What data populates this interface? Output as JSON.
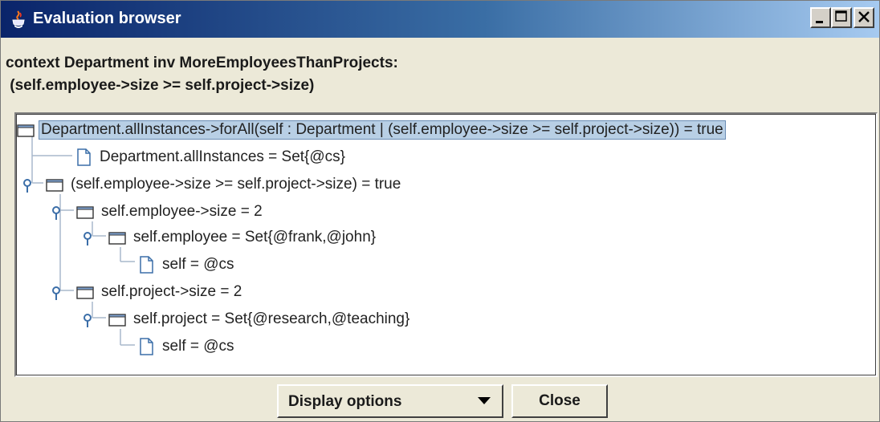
{
  "window": {
    "title": "Evaluation browser",
    "title_icon": "java-cup-icon",
    "controls": [
      "minimize-icon",
      "maximize-icon",
      "close-icon"
    ]
  },
  "context": {
    "line1": "context Department inv MoreEmployeesThanProjects:",
    "line2": " (self.employee->size >= self.project->size)"
  },
  "tree": {
    "nodes": [
      {
        "label": "Department.allInstances->forAll(self : Department | (self.employee->size >= self.project->size)) = true",
        "icon": "folder-icon",
        "selected": true
      },
      {
        "label": "Department.allInstances = Set{@cs}",
        "icon": "leaf-document-icon"
      },
      {
        "label": "(self.employee->size >= self.project->size) = true",
        "icon": "folder-icon"
      },
      {
        "label": "self.employee->size = 2",
        "icon": "folder-icon"
      },
      {
        "label": "self.employee = Set{@frank,@john}",
        "icon": "folder-icon"
      },
      {
        "label": "self = @cs",
        "icon": "leaf-document-icon"
      },
      {
        "label": "self.project->size = 2",
        "icon": "folder-icon"
      },
      {
        "label": "self.project = Set{@research,@teaching}",
        "icon": "folder-icon"
      },
      {
        "label": "self = @cs",
        "icon": "leaf-document-icon"
      }
    ]
  },
  "footer": {
    "display_options_label": "Display options",
    "close_label": "Close"
  },
  "colors": {
    "titlebar_start": "#0a246a",
    "titlebar_end": "#a6caf0",
    "selection": "#b8cfe5",
    "window_bg": "#ece9d8"
  }
}
